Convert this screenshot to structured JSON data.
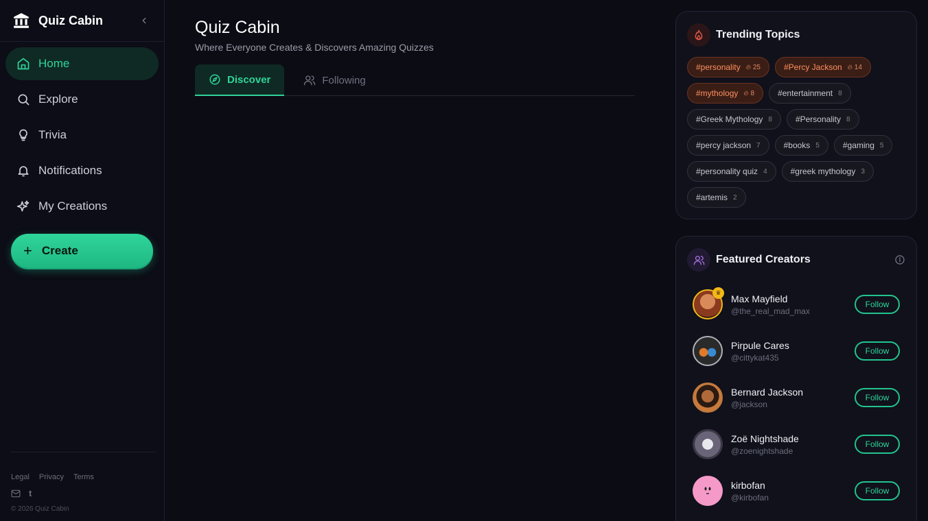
{
  "brand": {
    "name": "Quiz Cabin"
  },
  "nav": {
    "items": [
      {
        "label": "Home",
        "icon": "home-icon",
        "active": true
      },
      {
        "label": "Explore",
        "icon": "search-icon"
      },
      {
        "label": "Trivia",
        "icon": "lightbulb-icon"
      },
      {
        "label": "Notifications",
        "icon": "bell-icon"
      },
      {
        "label": "My Creations",
        "icon": "sparkles-icon"
      }
    ],
    "create_label": "Create"
  },
  "footer": {
    "links": [
      "Legal",
      "Privacy",
      "Terms"
    ],
    "copyright": "© 2026 Quiz Cabin"
  },
  "main": {
    "title": "Quiz Cabin",
    "subtitle": "Where Everyone Creates & Discovers Amazing Quizzes",
    "tabs": [
      {
        "label": "Discover",
        "icon": "compass-icon",
        "active": true
      },
      {
        "label": "Following",
        "icon": "users-icon"
      }
    ]
  },
  "trending": {
    "title": "Trending Topics",
    "tags": [
      {
        "label": "#personality",
        "count": "25",
        "hot": true
      },
      {
        "label": "#Percy Jackson",
        "count": "14",
        "hot": true
      },
      {
        "label": "#mythology",
        "count": "8",
        "hot": true
      },
      {
        "label": "#entertainment",
        "count": "8"
      },
      {
        "label": "#Greek Mythology",
        "count": "8"
      },
      {
        "label": "#Personality",
        "count": "8"
      },
      {
        "label": "#percy jackson",
        "count": "7"
      },
      {
        "label": "#books",
        "count": "5"
      },
      {
        "label": "#gaming",
        "count": "5"
      },
      {
        "label": "#personality quiz",
        "count": "4"
      },
      {
        "label": "#greek mythology",
        "count": "3"
      },
      {
        "label": "#artemis",
        "count": "2"
      }
    ]
  },
  "featured": {
    "title": "Featured Creators",
    "follow_label": "Follow",
    "creators": [
      {
        "name": "Max Mayfield",
        "handle": "@the_real_mad_max",
        "crown": true
      },
      {
        "name": "Pirpule Cares",
        "handle": "@cittykat435"
      },
      {
        "name": "Bernard Jackson",
        "handle": "@jackson"
      },
      {
        "name": "Zoë Nightshade",
        "handle": "@zoenightshade"
      },
      {
        "name": "kirbofan",
        "handle": "@kirbofan"
      }
    ]
  },
  "colors": {
    "accent": "#2fd49a",
    "background": "#0b0c14",
    "hot_tag": "#ff8f5e"
  }
}
